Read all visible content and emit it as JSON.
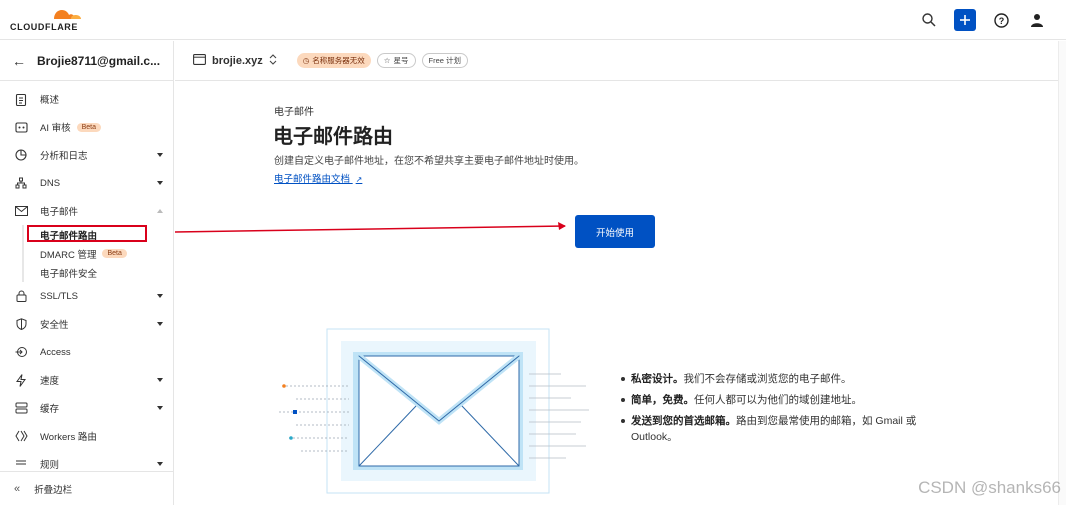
{
  "app": {
    "logo_text": "CLOUDFLARE"
  },
  "topbar": {
    "icons": [
      "search-icon",
      "plus-icon",
      "help-icon",
      "user-icon"
    ]
  },
  "sidebar": {
    "account": "Brojie8711@gmail.c...",
    "items": [
      {
        "label": "概述",
        "icon": "clipboard-icon"
      },
      {
        "label": "AI 审核",
        "icon": "ai-audit-icon",
        "badge": "Beta"
      },
      {
        "label": "分析和日志",
        "icon": "analytics-icon",
        "expand": true
      },
      {
        "label": "DNS",
        "icon": "dns-icon",
        "expand": true
      },
      {
        "label": "电子邮件",
        "icon": "email-icon",
        "expand": true,
        "expanded": true
      },
      {
        "label": "SSL/TLS",
        "icon": "lock-icon",
        "expand": true
      },
      {
        "label": "安全性",
        "icon": "shield-icon",
        "expand": true
      },
      {
        "label": "Access",
        "icon": "access-icon"
      },
      {
        "label": "速度",
        "icon": "bolt-icon",
        "expand": true
      },
      {
        "label": "缓存",
        "icon": "cache-icon",
        "expand": true
      },
      {
        "label": "Workers 路由",
        "icon": "workers-icon"
      },
      {
        "label": "规则",
        "icon": "rules-icon",
        "expand": true
      }
    ],
    "email_sub": [
      {
        "label": "电子邮件路由",
        "active": true
      },
      {
        "label": "DMARC 管理",
        "badge": "Beta"
      },
      {
        "label": "电子邮件安全"
      }
    ],
    "collapse_label": "折叠边栏"
  },
  "header": {
    "domain": "brojie.xyz",
    "status_pill": "名称服务器无效",
    "star_pill": "星号",
    "plan_pill": "Free 计划"
  },
  "main": {
    "breadcrumb": "电子邮件",
    "title": "电子邮件路由",
    "description": "创建自定义电子邮件地址，在您不希望共享主要电子邮件地址时使用。",
    "doc_link": "电子邮件路由文档",
    "start_button": "开始使用",
    "features": [
      {
        "bold": "私密设计。",
        "text": "我们不会存储或浏览您的电子邮件。"
      },
      {
        "bold": "简单，免费。",
        "text": "任何人都可以为他们的域创建地址。"
      },
      {
        "bold": "发送到您的首选邮箱。",
        "text": "路由到您最常使用的邮箱，如 Gmail 或 Outlook。"
      }
    ]
  },
  "colors": {
    "accent": "#0051c3",
    "annotation": "#d9001b",
    "warn_pill": "#fcd9bd"
  },
  "watermark": "CSDN @shanks66"
}
